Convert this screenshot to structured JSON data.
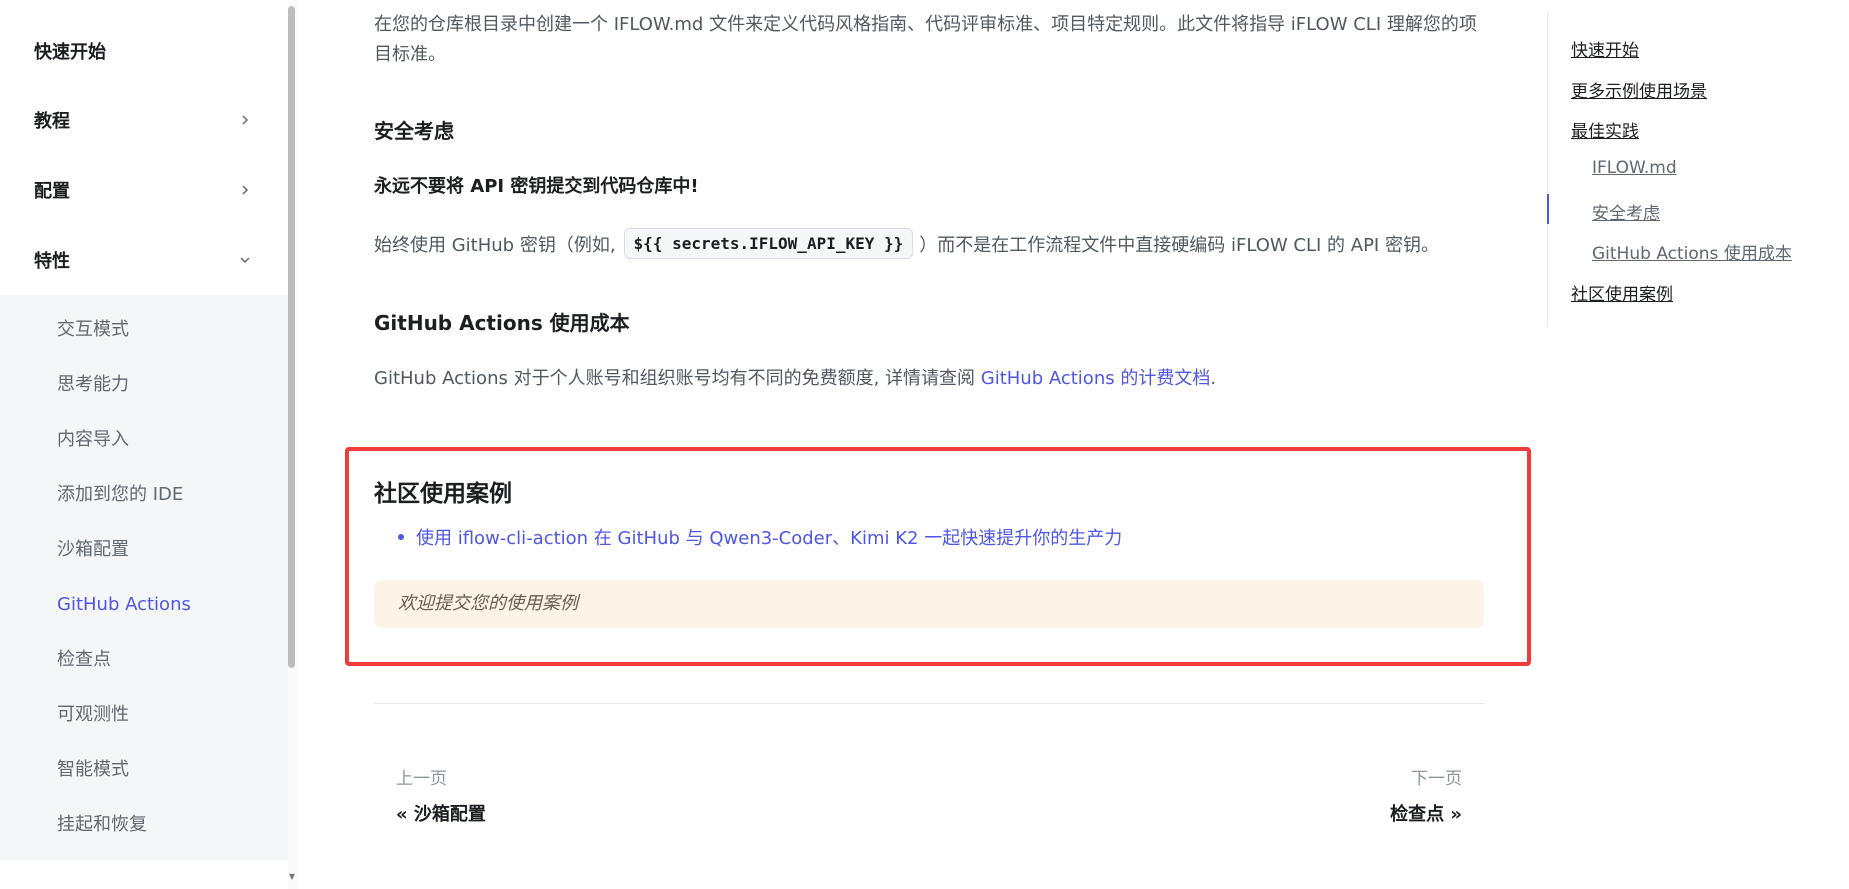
{
  "sidebar": {
    "top_items": [
      {
        "label": "快速开始"
      },
      {
        "label": "教程"
      },
      {
        "label": "配置"
      },
      {
        "label": "特性"
      }
    ],
    "sub_items": [
      {
        "label": "交互模式"
      },
      {
        "label": "思考能力"
      },
      {
        "label": "内容导入"
      },
      {
        "label": "添加到您的 IDE"
      },
      {
        "label": "沙箱配置"
      },
      {
        "label": "GitHub Actions"
      },
      {
        "label": "检查点"
      },
      {
        "label": "可观测性"
      },
      {
        "label": "智能模式"
      },
      {
        "label": "挂起和恢复"
      }
    ],
    "active_sub_item": "GitHub Actions"
  },
  "main": {
    "intro_text": "在您的仓库根目录中创建一个 IFLOW.md 文件来定义代码风格指南、代码评审标准、项目特定规则。此文件将指导 iFLOW CLI 理解您的项目标准。",
    "security": {
      "heading": "安全考虑",
      "warning": "永远不要将 API 密钥提交到代码仓库中!",
      "text_before": "始终使用 GitHub 密钥（例如,",
      "code": "${{ secrets.IFLOW_API_KEY }}",
      "text_after": "）而不是在工作流程文件中直接硬编码 iFLOW CLI 的 API 密钥。"
    },
    "cost": {
      "heading": "GitHub Actions 使用成本",
      "text": "GitHub Actions 对于个人账号和组织账号均有不同的免费额度, 详情请查阅",
      "link": "GitHub Actions 的计费文档",
      "suffix": "."
    },
    "community": {
      "heading": "社区使用案例",
      "case_link": "使用 iflow-cli-action 在 GitHub 与 Qwen3-Coder、Kimi K2 一起快速提升你的生产力",
      "note": "欢迎提交您的使用案例"
    },
    "pager": {
      "prev_label": "上一页",
      "prev_title": "« 沙箱配置",
      "next_label": "下一页",
      "next_title": "检查点 »"
    }
  },
  "toc": {
    "items": [
      {
        "label": "快速开始"
      },
      {
        "label": "更多示例使用场景"
      },
      {
        "label": "最佳实践"
      },
      {
        "label": "IFLOW.md"
      },
      {
        "label": "安全考虑"
      },
      {
        "label": "GitHub Actions 使用成本"
      },
      {
        "label": "社区使用案例"
      }
    ],
    "active": "安全考虑"
  },
  "colors": {
    "accent": "#4f56e4",
    "highlight_border": "#ef3b3b",
    "note_background": "#fdf3e7"
  }
}
